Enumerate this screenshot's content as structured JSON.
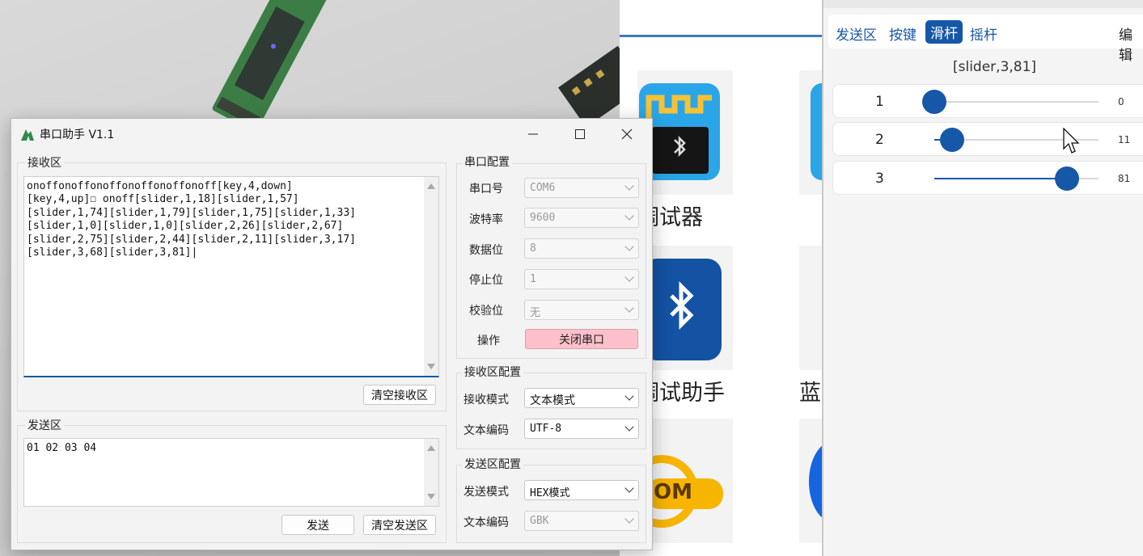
{
  "store": {
    "app_names": [
      "调试器",
      "调试助手",
      "蓝"
    ],
    "tile3_text": "OM"
  },
  "window": {
    "title": "串口助手 V1.1",
    "receive": {
      "label": "接收区",
      "content": "onoffonoffonoffonoffonoffonoff[key,4,down]\n[key,4,up]☐ onoff[slider,1,18][slider,1,57]\n[slider,1,74][slider,1,79][slider,1,75][slider,1,33]\n[slider,1,0][slider,1,0][slider,2,26][slider,2,67]\n[slider,2,75][slider,2,44][slider,2,11][slider,3,17]\n[slider,3,68][slider,3,81]|",
      "clear_button": "清空接收区"
    },
    "send": {
      "label": "发送区",
      "content": "01 02 03 04",
      "send_button": "发送",
      "clear_button": "清空发送区"
    },
    "serial_config": {
      "label": "串口配置",
      "port_label": "串口号",
      "port": "COM6",
      "baud_label": "波特率",
      "baud": "9600",
      "databits_label": "数据位",
      "databits": "8",
      "stopbits_label": "停止位",
      "stopbits": "1",
      "parity_label": "校验位",
      "parity": "无",
      "op_label": "操作",
      "op_button": "关闭串口"
    },
    "recv_config": {
      "label": "接收区配置",
      "mode_label": "接收模式",
      "mode": "文本模式",
      "encoding_label": "文本编码",
      "encoding": "UTF-8"
    },
    "send_config": {
      "label": "发送区配置",
      "mode_label": "发送模式",
      "mode": "HEX模式",
      "encoding_label": "文本编码",
      "encoding": "GBK"
    }
  },
  "phone": {
    "tabs": [
      "发送区",
      "按键",
      "滑杆",
      "摇杆"
    ],
    "active_tab": "滑杆",
    "edit_label": "编辑",
    "readout": "[slider,3,81]",
    "sliders": [
      {
        "index": "1",
        "value": "0",
        "fraction": 0.0
      },
      {
        "index": "2",
        "value": "11",
        "fraction": 0.11
      },
      {
        "index": "3",
        "value": "81",
        "fraction": 0.81
      }
    ],
    "accent": "#1757a8"
  }
}
